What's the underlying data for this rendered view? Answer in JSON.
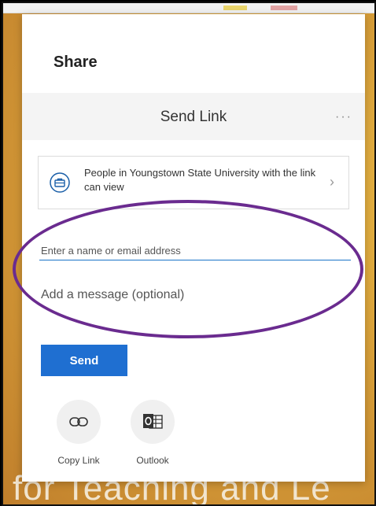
{
  "background": {
    "overlay_text": "for Teaching and Le",
    "accent": "#e6b84a"
  },
  "panel": {
    "title": "Share",
    "header": {
      "title": "Send Link",
      "more_icon": "more-horizontal-icon",
      "more_symbol": "···"
    },
    "permission": {
      "text": "People in Youngstown State University with the link can view",
      "icon": "briefcase-icon",
      "chevron": "›"
    },
    "recipient": {
      "placeholder": "Enter a name or email address",
      "value": ""
    },
    "message": {
      "placeholder": "Add a message (optional)",
      "value": ""
    },
    "send_label": "Send",
    "actions": [
      {
        "label": "Copy Link",
        "icon": "link-icon"
      },
      {
        "label": "Outlook",
        "icon": "outlook-icon"
      }
    ]
  },
  "colors": {
    "send_button": "#1f6fd1",
    "highlight": "#6a2b8f",
    "input_underline": "#1a73c8"
  }
}
